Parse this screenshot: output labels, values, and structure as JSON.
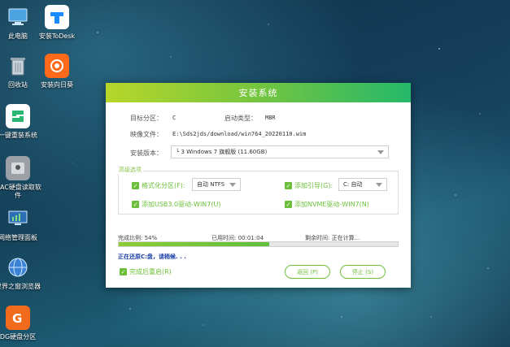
{
  "desktop": {
    "icons": [
      {
        "label": "此电脑"
      },
      {
        "label": "安装ToDesk"
      },
      {
        "label": "回收站"
      },
      {
        "label": "安装向日葵"
      },
      {
        "label": "一键重装系统"
      },
      {
        "label": "MAC硬盘读取软件"
      },
      {
        "label": "网络管理面板"
      },
      {
        "label": "世界之窗浏览器"
      },
      {
        "label": "DG硬盘分区"
      }
    ]
  },
  "dialog": {
    "title": "安装系统",
    "target_label": "目标分区：",
    "target_value": "C",
    "boot_label": "启动类型：",
    "boot_value": "MBR",
    "image_label": "映像文件：",
    "image_value": "E:\\Sds2jds/download/win764_20220110.wim",
    "version_label": "安装版本：",
    "version_value": "└ 3 Windows 7 旗舰版 (11.60GB)",
    "advanced_title": "高级选项",
    "format_label": "格式化分区(F):",
    "format_value": "自动  NTFS",
    "bootfix_label": "添加引导(G):",
    "bootfix_value": "C: 自动",
    "usb_label": "添加USB3.0驱动-WIN7(U)",
    "nvme_label": "添加NVME驱动-WIN7(N)",
    "progress_label": "完成比例: 54%",
    "progress_value": 0.54,
    "elapsed_label": "已用时间: 00:01:04",
    "remaining_label": "剩余时间: 正在计算...",
    "status_text": "正在还原C:盘，请稍候. . .",
    "reboot_label": "完成后重启(R)",
    "back_label": "返回 (P)",
    "stop_label": "停止 (S)"
  },
  "colors": {
    "accent": "#6cbf3a",
    "title_gradient_start": "#b7d62a",
    "title_gradient_end": "#25b86a",
    "status_text": "#1a3ea8"
  }
}
